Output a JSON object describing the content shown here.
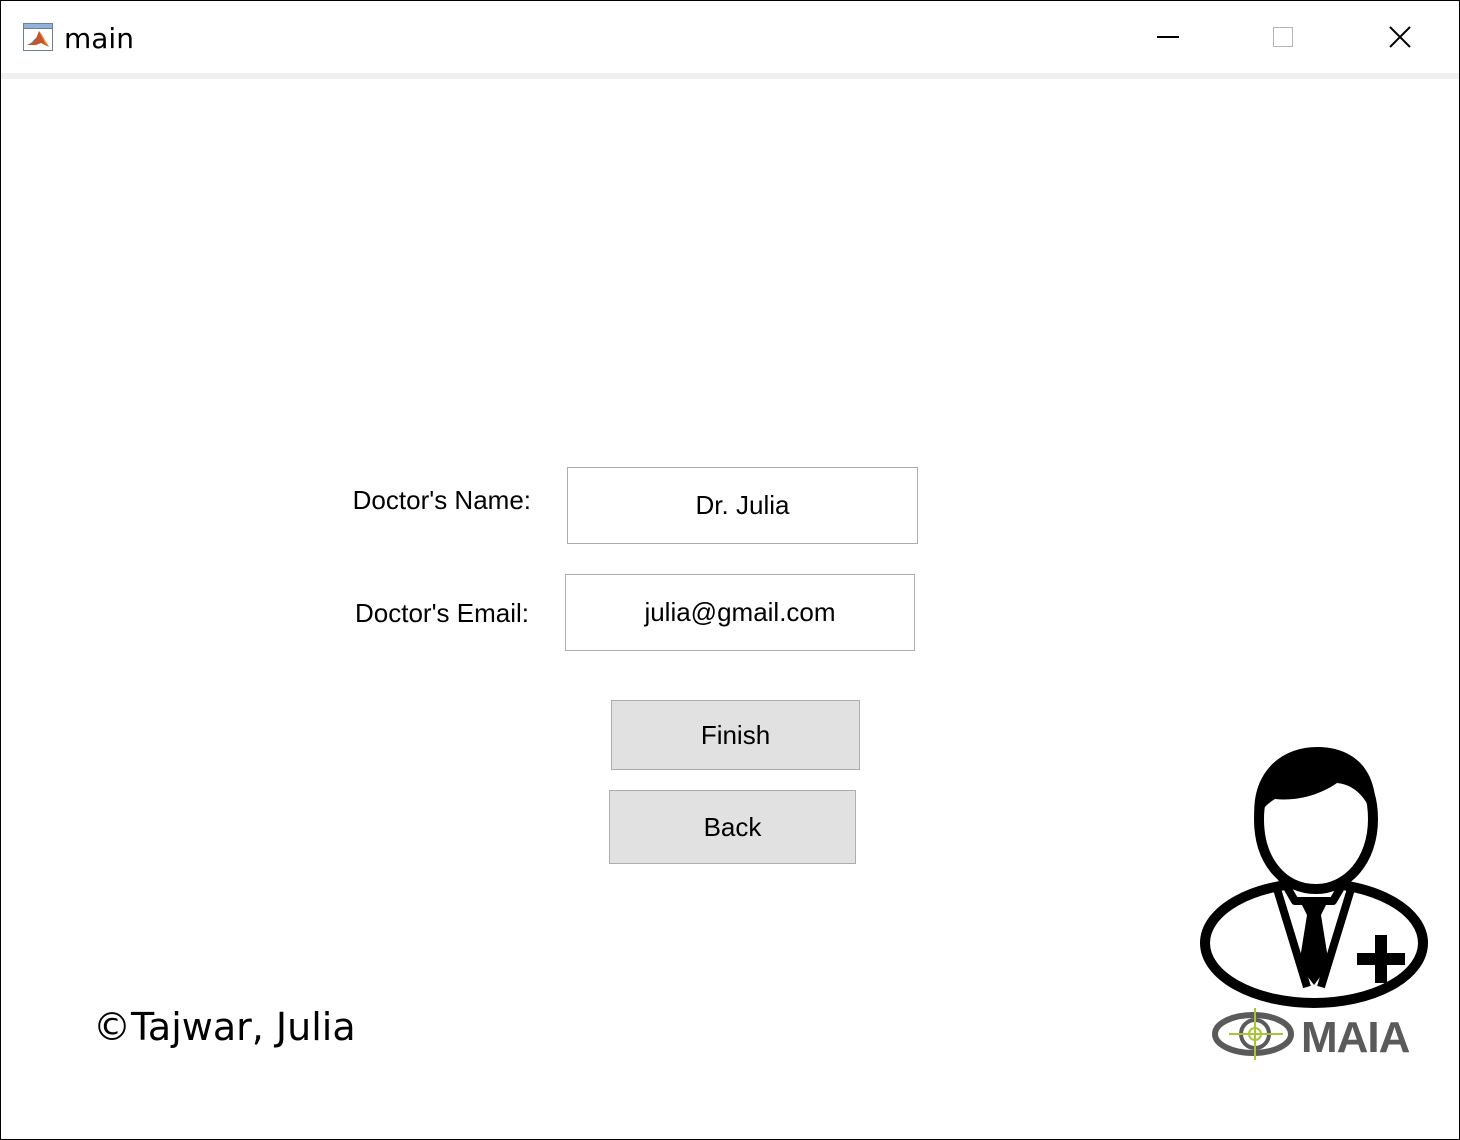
{
  "window": {
    "title": "main",
    "icon": "matlab-icon",
    "controls": {
      "minimize": "minimize-icon",
      "maximize": "maximize-icon",
      "close": "close-icon"
    }
  },
  "form": {
    "name_label": "Doctor's Name:",
    "name_value": "Dr. Julia",
    "email_label": "Doctor's Email:",
    "email_value": "julia@gmail.com"
  },
  "buttons": {
    "finish_label": "Finish",
    "back_label": "Back"
  },
  "footer": {
    "copyright": "©Tajwar, Julia"
  },
  "branding": {
    "logo_text": "MAIA",
    "doctor_icon": "doctor-avatar-icon",
    "colors": {
      "logo_gray": "#5a5a5a",
      "logo_accent": "#a8c43a"
    }
  }
}
